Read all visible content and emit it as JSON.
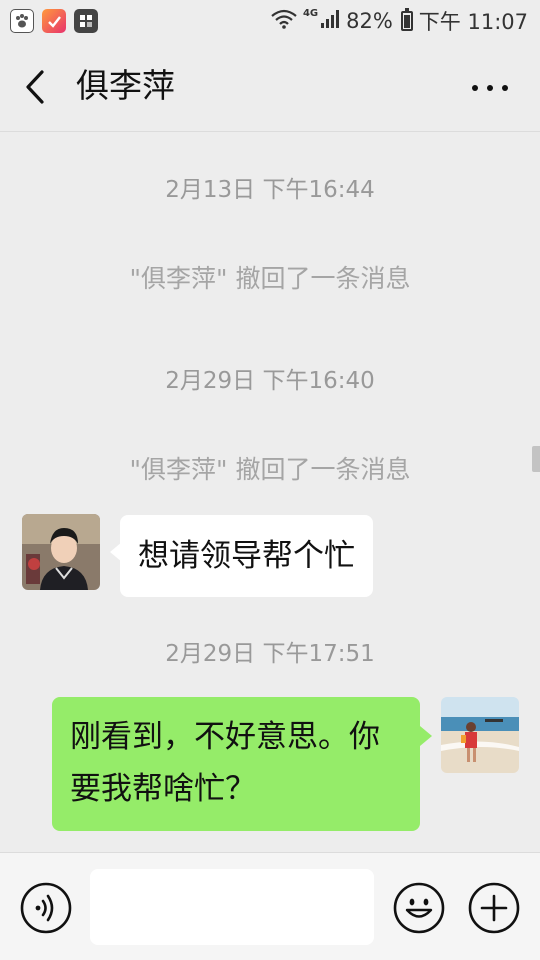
{
  "status_bar": {
    "signal_text": "4G",
    "battery_percent": "82%",
    "battery_level": 0.82,
    "time": "下午 11:07",
    "app_icons": [
      "baidu-app-icon",
      "music-app-icon",
      "tasks-app-icon"
    ]
  },
  "header": {
    "title": "俱李萍",
    "back_icon": "chevron-left-icon",
    "more_icon": "more-dots-icon"
  },
  "messages": {
    "ts1": "2月13日 下午16:44",
    "recall1": "\"俱李萍\" 撤回了一条消息",
    "ts2": "2月29日 下午16:40",
    "recall2": "\"俱李萍\" 撤回了一条消息",
    "incoming_text": "想请领导帮个忙",
    "ts3": "2月29日 下午17:51",
    "outgoing_line1": "刚看到，不好意思。你",
    "outgoing_line2": "要我帮啥忙？"
  },
  "input_bar": {
    "voice_icon": "voice-icon",
    "input_value": "",
    "emoji_icon": "emoji-icon",
    "plus_icon": "plus-icon"
  },
  "colors": {
    "background": "#ededed",
    "outgoing_bubble": "#95ec69",
    "incoming_bubble": "#ffffff",
    "timestamp_text": "#999999"
  }
}
